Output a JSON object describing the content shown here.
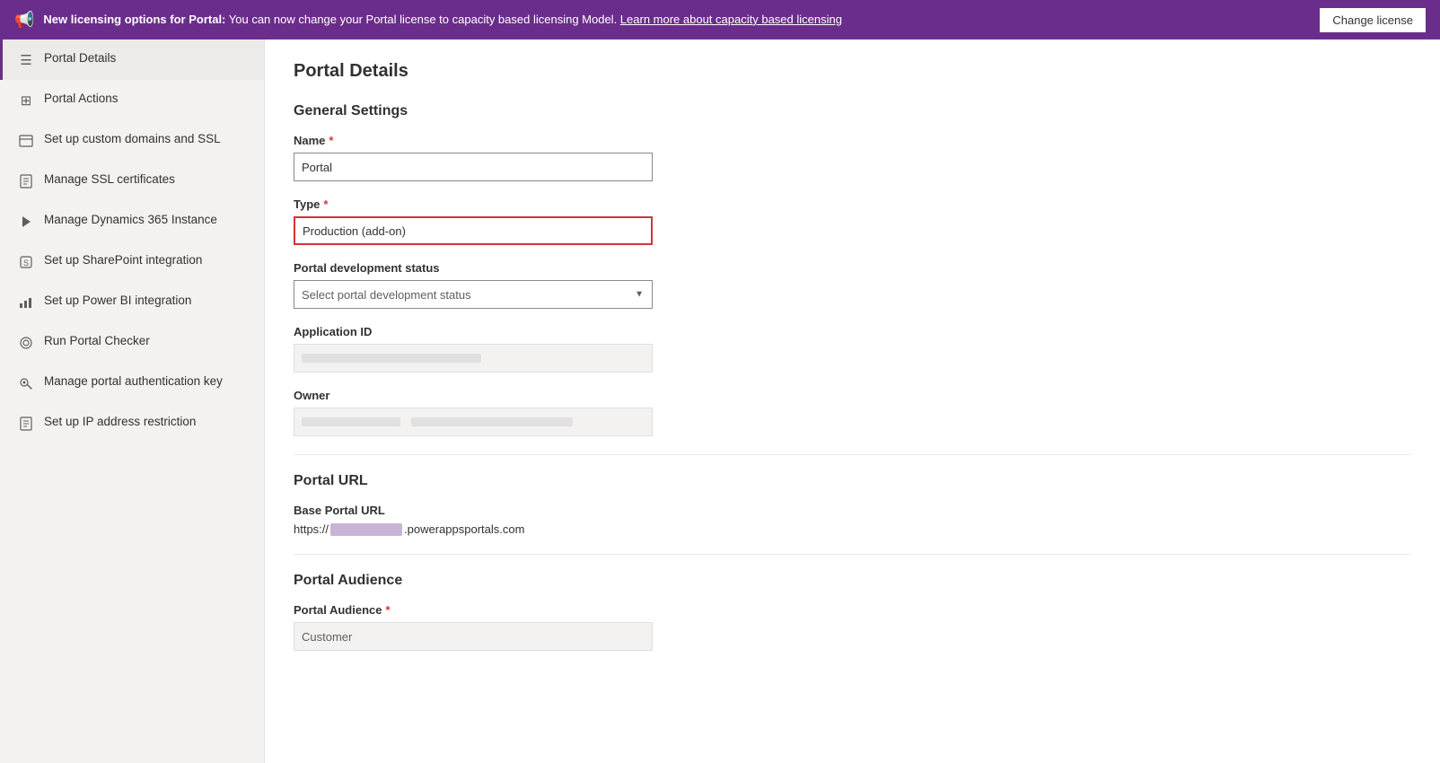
{
  "banner": {
    "icon": "📢",
    "text_bold": "New licensing options for Portal:",
    "text": " You can now change your Portal license to capacity based licensing Model. ",
    "link": "Learn more about capacity based licensing",
    "button": "Change license"
  },
  "sidebar": {
    "items": [
      {
        "id": "portal-details",
        "label": "Portal Details",
        "icon": "☰",
        "active": true
      },
      {
        "id": "portal-actions",
        "label": "Portal Actions",
        "icon": "⊞",
        "active": false
      },
      {
        "id": "custom-domains",
        "label": "Set up custom domains and SSL",
        "icon": "⊡",
        "active": false
      },
      {
        "id": "ssl-certs",
        "label": "Manage SSL certificates",
        "icon": "📄",
        "active": false
      },
      {
        "id": "dynamics-instance",
        "label": "Manage Dynamics 365 Instance",
        "icon": "▶",
        "active": false
      },
      {
        "id": "sharepoint",
        "label": "Set up SharePoint integration",
        "icon": "S",
        "active": false
      },
      {
        "id": "power-bi",
        "label": "Set up Power BI integration",
        "icon": "📊",
        "active": false
      },
      {
        "id": "portal-checker",
        "label": "Run Portal Checker",
        "icon": "⊙",
        "active": false
      },
      {
        "id": "auth-key",
        "label": "Manage portal authentication key",
        "icon": "🔒",
        "active": false
      },
      {
        "id": "ip-restriction",
        "label": "Set up IP address restriction",
        "icon": "📋",
        "active": false
      }
    ]
  },
  "main": {
    "page_title": "Portal Details",
    "general_settings_title": "General Settings",
    "name_label": "Name",
    "name_value": "Portal",
    "name_placeholder": "Portal",
    "name_required": "*",
    "type_label": "Type",
    "type_value": "Production (add-on)",
    "type_required": "*",
    "portal_dev_status_label": "Portal development status",
    "portal_dev_status_placeholder": "Select portal development status",
    "app_id_label": "Application ID",
    "owner_label": "Owner",
    "portal_url_title": "Portal URL",
    "base_url_label": "Base Portal URL",
    "base_url_prefix": "https://",
    "base_url_suffix": ".powerappsportals.com",
    "portal_audience_title": "Portal Audience",
    "portal_audience_label": "Portal Audience",
    "portal_audience_required": "*",
    "portal_audience_value": "Customer"
  }
}
